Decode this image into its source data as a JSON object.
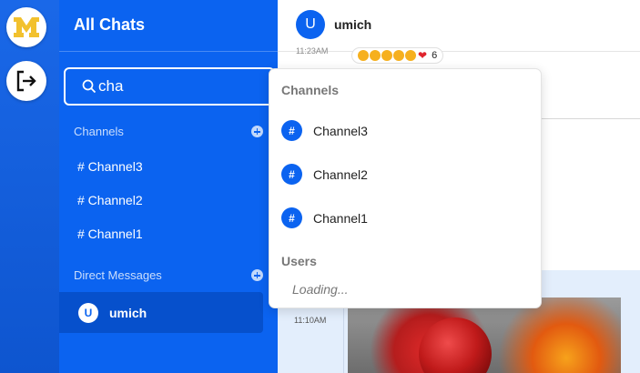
{
  "rail": {
    "logo_text": "M",
    "logout_icon": "logout-icon"
  },
  "sidebar": {
    "title": "All Chats",
    "search": {
      "value": "cha",
      "icon": "search-icon"
    },
    "channels_label": "Channels",
    "channels": [
      {
        "label": "# Channel3"
      },
      {
        "label": "# Channel2"
      },
      {
        "label": "# Channel1"
      }
    ],
    "dm_label": "Direct Messages",
    "dms": [
      {
        "avatar": "U",
        "name": "umich"
      }
    ]
  },
  "main": {
    "header": {
      "avatar": "U",
      "name": "umich"
    },
    "top_time": "11:23AM",
    "reactions": {
      "count": "6"
    },
    "bottom_time": "11:10AM"
  },
  "dropdown": {
    "channels_heading": "Channels",
    "channels": [
      {
        "hash": "#",
        "label": "Channel3"
      },
      {
        "hash": "#",
        "label": "Channel2"
      },
      {
        "hash": "#",
        "label": "Channel1"
      }
    ],
    "users_heading": "Users",
    "loading": "Loading..."
  },
  "colors": {
    "sidebar": "#0b63f0",
    "rail": "#1a68e8",
    "active_dm": "#0650cc",
    "logo_maize": "#f2c12e"
  }
}
